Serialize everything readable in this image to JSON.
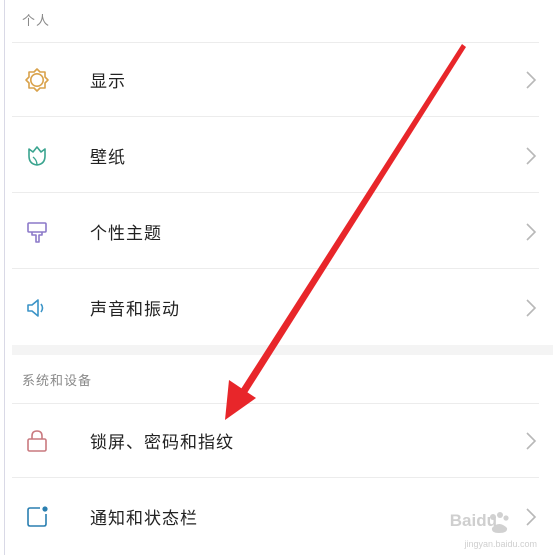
{
  "sections": [
    {
      "header": "个人",
      "items": [
        {
          "label": "显示",
          "icon": "sun-icon",
          "color": "#d9a24b"
        },
        {
          "label": "壁纸",
          "icon": "tulip-icon",
          "color": "#3aa48f"
        },
        {
          "label": "个性主题",
          "icon": "brush-icon",
          "color": "#8c79c9"
        },
        {
          "label": "声音和振动",
          "icon": "speaker-icon",
          "color": "#3b94c7"
        }
      ]
    },
    {
      "header": "系统和设备",
      "items": [
        {
          "label": "锁屏、密码和指纹",
          "icon": "lock-icon",
          "color": "#c9797f"
        },
        {
          "label": "通知和状态栏",
          "icon": "notification-icon",
          "color": "#2a7fb0"
        }
      ]
    }
  ],
  "annotation": {
    "arrow_color": "#e8262a"
  },
  "watermark": {
    "text": "Baidu",
    "sub": "jingyan.baidu.com"
  }
}
